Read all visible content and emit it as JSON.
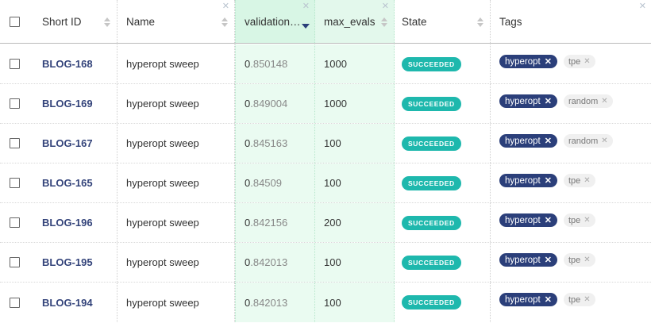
{
  "columns": {
    "short_id": "Short ID",
    "name": "Name",
    "validation": "validation…",
    "max_evals": "max_evals",
    "state": "State",
    "tags": "Tags"
  },
  "icons": {
    "close": "✕",
    "tag_remove": "✕"
  },
  "rows": [
    {
      "id": "BLOG-168",
      "name": "hyperopt sweep",
      "val_int": "0",
      "val_dec": ".850148",
      "max_evals": "1000",
      "state": "SUCCEEDED",
      "tag1": "hyperopt",
      "tag2": "tpe"
    },
    {
      "id": "BLOG-169",
      "name": "hyperopt sweep",
      "val_int": "0",
      "val_dec": ".849004",
      "max_evals": "1000",
      "state": "SUCCEEDED",
      "tag1": "hyperopt",
      "tag2": "random"
    },
    {
      "id": "BLOG-167",
      "name": "hyperopt sweep",
      "val_int": "0",
      "val_dec": ".845163",
      "max_evals": "100",
      "state": "SUCCEEDED",
      "tag1": "hyperopt",
      "tag2": "random"
    },
    {
      "id": "BLOG-165",
      "name": "hyperopt sweep",
      "val_int": "0",
      "val_dec": ".84509",
      "max_evals": "100",
      "state": "SUCCEEDED",
      "tag1": "hyperopt",
      "tag2": "tpe"
    },
    {
      "id": "BLOG-196",
      "name": "hyperopt sweep",
      "val_int": "0",
      "val_dec": ".842156",
      "max_evals": "200",
      "state": "SUCCEEDED",
      "tag1": "hyperopt",
      "tag2": "tpe"
    },
    {
      "id": "BLOG-195",
      "name": "hyperopt sweep",
      "val_int": "0",
      "val_dec": ".842013",
      "max_evals": "100",
      "state": "SUCCEEDED",
      "tag1": "hyperopt",
      "tag2": "tpe"
    },
    {
      "id": "BLOG-194",
      "name": "hyperopt sweep",
      "val_int": "0",
      "val_dec": ".842013",
      "max_evals": "100",
      "state": "SUCCEEDED",
      "tag1": "hyperopt",
      "tag2": "tpe"
    }
  ],
  "colors": {
    "accent": "#2b3f7a",
    "succeeded": "#1eb8ad",
    "highlight_column": "#eafbf1"
  }
}
